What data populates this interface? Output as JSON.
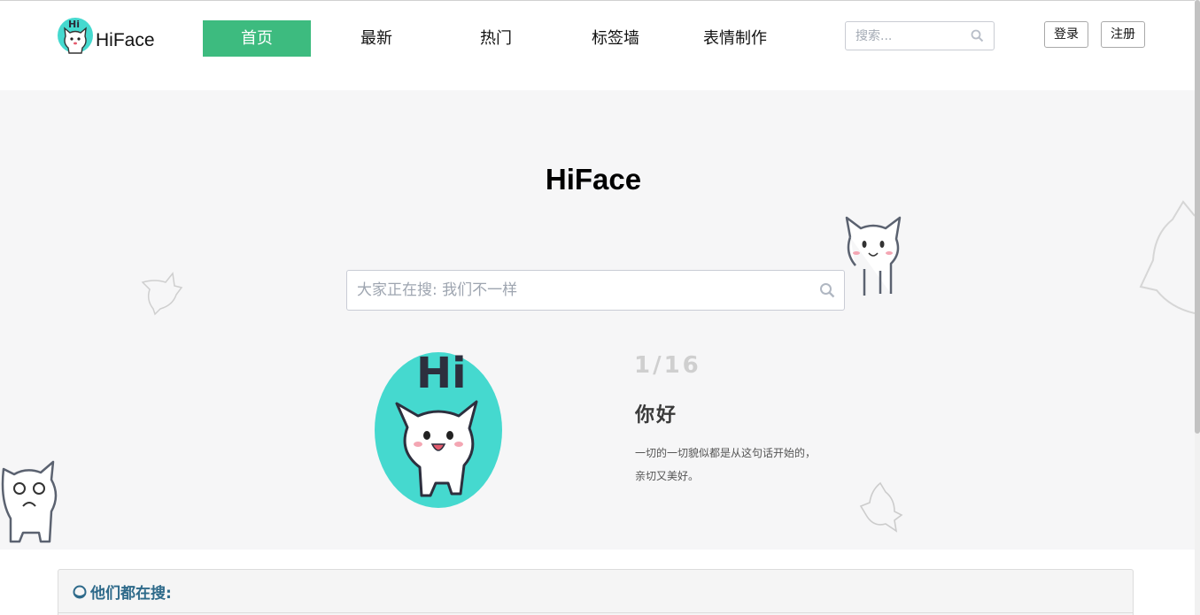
{
  "brand": {
    "name": "HiFace",
    "logo_text": "Hi",
    "accent": "#3dbb7f"
  },
  "nav": {
    "items": [
      {
        "label": "首页",
        "active": true
      },
      {
        "label": "最新",
        "active": false
      },
      {
        "label": "热门",
        "active": false
      },
      {
        "label": "标签墙",
        "active": false
      },
      {
        "label": "表情制作",
        "active": false
      }
    ]
  },
  "header_search": {
    "placeholder": "搜索...",
    "icon": "search-icon"
  },
  "auth": {
    "login_label": "登录",
    "register_label": "注册"
  },
  "hero": {
    "title": "HiFace",
    "search": {
      "placeholder": "大家正在搜: 我们不一样",
      "icon": "search-icon"
    },
    "slide": {
      "image_text": "Hi",
      "counter": "1/16",
      "title": "你好",
      "desc_line1": "一切的一切貌似都是从这句话开始的，",
      "desc_line2": "亲切又美好。",
      "image_bg": "#45d9cf"
    }
  },
  "panel": {
    "heading": "他们都在搜:",
    "heading_color": "#2e6a8a"
  }
}
